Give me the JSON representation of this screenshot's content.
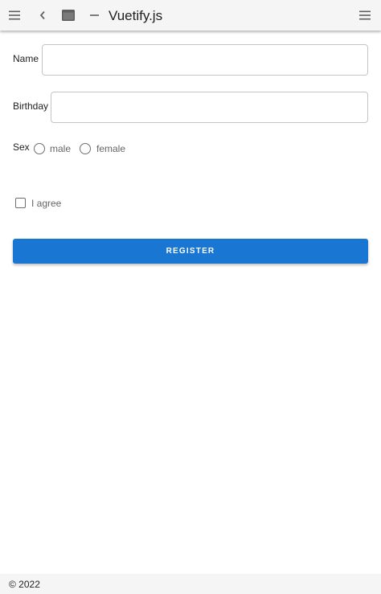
{
  "appbar": {
    "title": "Vuetify.js",
    "nav_icon": "menu-icon",
    "back_icon": "chevron-left-icon",
    "window_icon": "web-asset-icon",
    "minus_icon": "minus-icon",
    "right_icon": "menu-icon"
  },
  "form": {
    "name_label": "Name",
    "name_value": "",
    "birthday_label": "Birthday",
    "birthday_value": "",
    "sex_label": "Sex",
    "sex_options": [
      "male",
      "female"
    ],
    "agree_label": "I agree",
    "register_label": "REGISTER"
  },
  "footer": {
    "text": "© 2022"
  },
  "colors": {
    "appbar_bg": "#f5f5f5",
    "primary": "#1976d2",
    "text": "#212121",
    "muted_text": "#666666",
    "border": "#c4c4c4"
  }
}
